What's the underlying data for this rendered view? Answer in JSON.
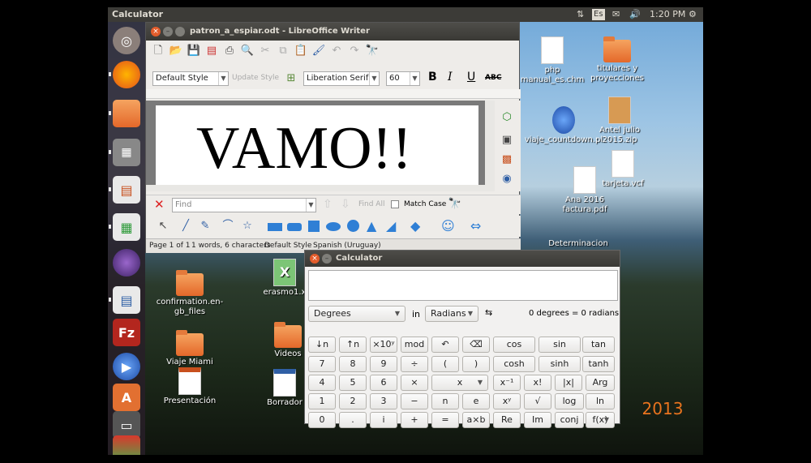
{
  "top_panel": {
    "app_title": "Calculator",
    "keyboard_layout": "Es",
    "time": "1:20 PM"
  },
  "launcher": {
    "items": [
      "ubuntu-dash",
      "firefox",
      "files",
      "calculator",
      "impress",
      "calc",
      "eclipse",
      "writer",
      "filezilla",
      "media-player",
      "software-center",
      "unity-tweak",
      "terminal"
    ]
  },
  "desktop": {
    "left_icons": [
      {
        "label": "confirmation.en-gb_files",
        "type": "folder"
      },
      {
        "label": "Viaje Miami 2016",
        "type": "folder"
      },
      {
        "label": "Presentación",
        "type": "doc"
      },
      {
        "label": "Videos",
        "type": "folder"
      },
      {
        "label": "erasmo1.x",
        "type": "xls"
      },
      {
        "label": "Borrador",
        "type": "doc"
      }
    ],
    "right_icons": [
      {
        "label": "php manual_es.chm",
        "type": "doc"
      },
      {
        "label": "titulares y proyecciones",
        "type": "folder"
      },
      {
        "label": "viaje_countdown.pl",
        "type": "video"
      },
      {
        "label": "Antel julio 2015.zip",
        "type": "zip"
      },
      {
        "label": "tarjeta.vcf",
        "type": "doc"
      },
      {
        "label": "Ana 2016 factura.pdf",
        "type": "doc"
      },
      {
        "label": "Determinacion Impuesto",
        "type": "doc"
      },
      {
        "label": "2013",
        "type": "text"
      }
    ]
  },
  "writer": {
    "title": "patron_a_espiar.odt - LibreOffice Writer",
    "paragraph_style": "Default Style",
    "update_style": "Update Style",
    "font_name": "Liberation Serif",
    "font_size": "60",
    "bold": "B",
    "italic": "I",
    "underline": "U",
    "strike": "ABC",
    "document_text": "VAMO!!",
    "find_placeholder": "Find",
    "find_all": "Find All",
    "match_case": "Match Case",
    "status": {
      "page": "Page 1 of 1",
      "words": "1 words, 6 characters",
      "style": "Default Style",
      "language": "Spanish (Uruguay)"
    }
  },
  "calculator": {
    "title": "Calculator",
    "display_value": "",
    "from_unit": "Degrees",
    "in_label": "in",
    "to_unit": "Radians",
    "conversion": "0 degrees = 0 radians",
    "rows": [
      [
        "↓n",
        "↑n",
        "×10ʸ",
        "mod",
        "↶",
        "⌫",
        "cos",
        "sin",
        "tan"
      ],
      [
        "7",
        "8",
        "9",
        "÷",
        "(",
        ")",
        "cosh",
        "sinh",
        "tanh"
      ],
      [
        "4",
        "5",
        "6",
        "×",
        "x",
        "x⁻¹",
        "x!",
        "|x|",
        "Arg"
      ],
      [
        "1",
        "2",
        "3",
        "−",
        "n",
        "e",
        "xʸ",
        "√",
        "log",
        "ln"
      ],
      [
        "0",
        ".",
        "i",
        "+",
        "=",
        "a×b",
        "Re",
        "Im",
        "conj",
        "f(x)"
      ]
    ]
  }
}
